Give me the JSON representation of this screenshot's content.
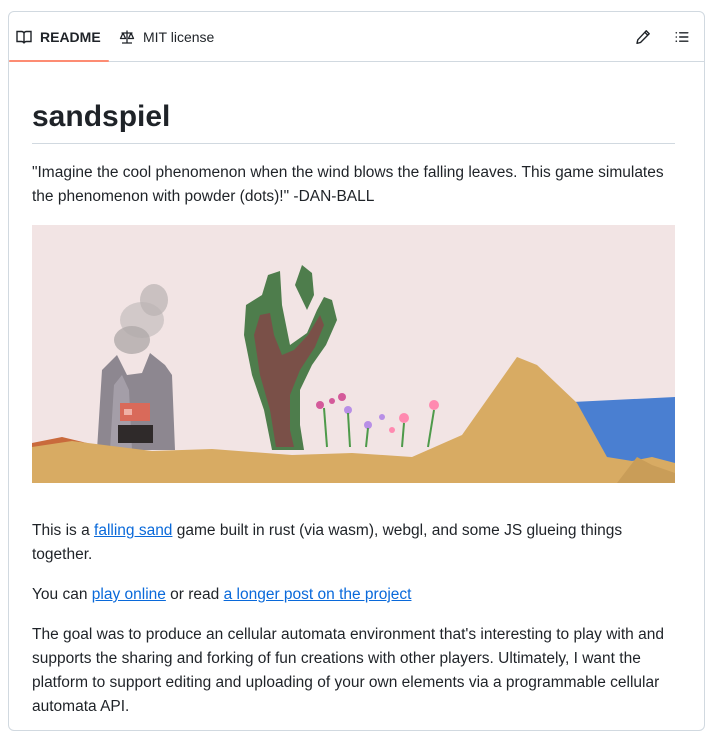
{
  "tabs": [
    {
      "label": "README",
      "icon": "book-icon",
      "active": true
    },
    {
      "label": "MIT license",
      "icon": "scale-icon",
      "active": false
    }
  ],
  "toolbar": {
    "edit_icon": "pencil-icon",
    "outline_icon": "list-icon"
  },
  "readme": {
    "title": "sandspiel",
    "quote": "\"Imagine the cool phenomenon when the wind blows the falling leaves. This game simulates the phenomenon with powder (dots)!\" -DAN-BALL",
    "p1": {
      "pre": "This is a ",
      "link": "falling sand",
      "post": " game built in rust (via wasm), webgl, and some JS glueing things together."
    },
    "p2": {
      "pre": "You can ",
      "link1": "play online",
      "mid": " or read ",
      "link2": "a longer post on the project"
    },
    "p3": "The goal was to produce an cellular automata environment that's interesting to play with and supports the sharing and forking of fun creations with other players. Ultimately, I want the platform to support editing and uploading of your own elements via a programmable cellular automata API."
  },
  "colors": {
    "accent_underline": "#fd8c73",
    "link": "#0969da",
    "sky": "#f2e4e4",
    "sand": "#d8ab63",
    "water": "#4a7fd1"
  }
}
